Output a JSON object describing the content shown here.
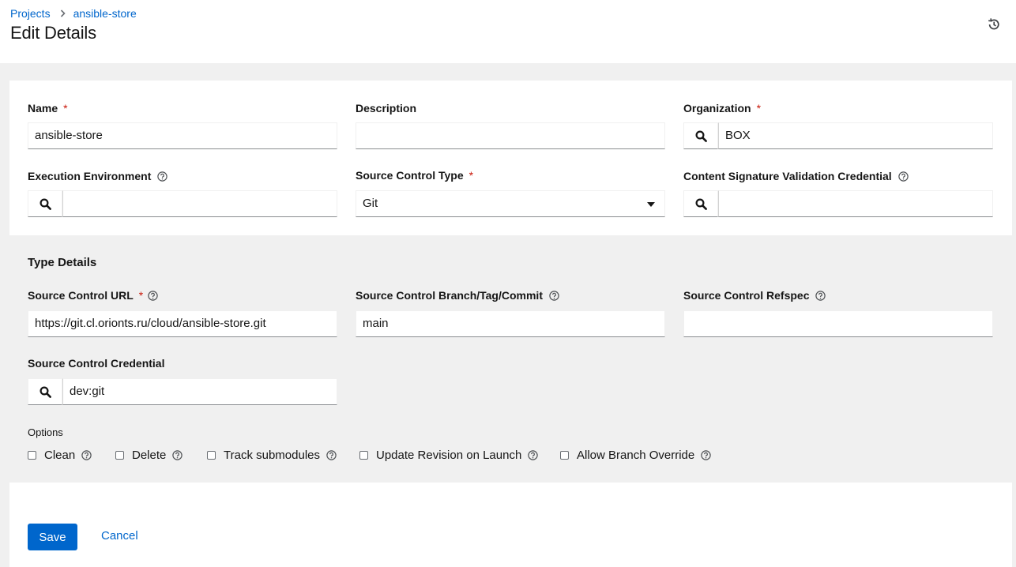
{
  "breadcrumb": {
    "parent": "Projects",
    "current": "ansible-store"
  },
  "page": {
    "title": "Edit Details"
  },
  "form": {
    "name": {
      "label": "Name",
      "value": "ansible-store"
    },
    "description": {
      "label": "Description",
      "value": ""
    },
    "organization": {
      "label": "Organization",
      "value": "BOX"
    },
    "execution_environment": {
      "label": "Execution Environment",
      "value": ""
    },
    "source_control_type": {
      "label": "Source Control Type",
      "value": "Git"
    },
    "content_signature": {
      "label": "Content Signature Validation Credential",
      "value": ""
    },
    "type_details": {
      "title": "Type Details",
      "scm_url": {
        "label": "Source Control URL",
        "value": "https://git.cl.orionts.ru/cloud/ansible-store.git"
      },
      "scm_branch": {
        "label": "Source Control Branch/Tag/Commit",
        "value": "main"
      },
      "scm_refspec": {
        "label": "Source Control Refspec",
        "value": ""
      },
      "scm_credential": {
        "label": "Source Control Credential",
        "value": "dev:git"
      },
      "options": {
        "label": "Options",
        "items": [
          {
            "label": "Clean",
            "checked": false
          },
          {
            "label": "Delete",
            "checked": false
          },
          {
            "label": "Track submodules",
            "checked": false
          },
          {
            "label": "Update Revision on Launch",
            "checked": false
          },
          {
            "label": "Allow Branch Override",
            "checked": false
          }
        ]
      }
    },
    "required_marker": "*"
  },
  "actions": {
    "save": "Save",
    "cancel": "Cancel"
  },
  "colors": {
    "primary": "#0066cc",
    "required": "#c9190b",
    "section_bg": "#f0f0f0"
  },
  "icons": {
    "breadcrumb_separator": "chevron-right-icon",
    "history": "history-icon",
    "lookup": "search-icon",
    "help": "question-circle-icon",
    "select": "caret-down-icon"
  }
}
